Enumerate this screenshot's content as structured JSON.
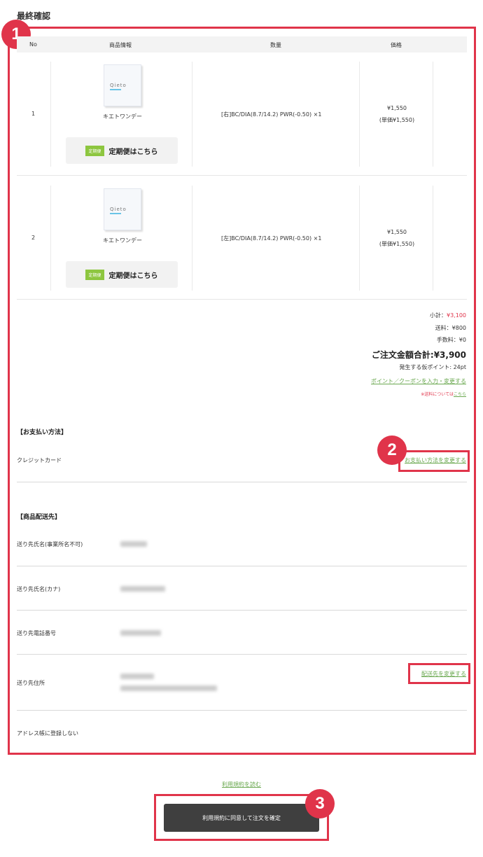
{
  "page": {
    "title": "最終確認"
  },
  "annotations": [
    "1",
    "2",
    "3"
  ],
  "table": {
    "headers": {
      "no": "No",
      "product": "商品情報",
      "qty": "数量",
      "price": "価格"
    },
    "rows": [
      {
        "no": "1",
        "logo": "Qieto",
        "name": "キエトワンデー",
        "sub_tag": "定期便",
        "sub_label": "定期便はこちら",
        "qty": "[右]BC/DIA(8.7/14.2) PWR(-0.50) ×1",
        "price": "¥1,550",
        "unit_price": "(単価¥1,550)"
      },
      {
        "no": "2",
        "logo": "Qieto",
        "name": "キエトワンデー",
        "sub_tag": "定期便",
        "sub_label": "定期便はこちら",
        "qty": "[左]BC/DIA(8.7/14.2) PWR(-0.50) ×1",
        "price": "¥1,550",
        "unit_price": "(単価¥1,550)"
      }
    ]
  },
  "totals": {
    "subtotal_label": "小計：",
    "subtotal_value": "¥3,100",
    "shipping": "送料：¥800",
    "fee": "手数料：¥0",
    "grand_total": "ご注文金額合計:¥3,900",
    "points": "発生する仮ポイント: 24pt",
    "coupon_link": "ポイント／クーポンを入力・変更する",
    "shipping_note_prefix": "※送料については",
    "shipping_note_link": "こちら"
  },
  "payment": {
    "title": "【お支払い方法】",
    "method": "クレジットカード",
    "change_link": "お支払い方法を変更する"
  },
  "delivery": {
    "title": "【商品配送先】",
    "name_label": "送り先氏名(事業所名不可)",
    "kana_label": "送り先氏名(カナ)",
    "phone_label": "送り先電話番号",
    "address_label": "送り先住所",
    "change_link": "配送先を変更する",
    "no_register": "アドレス帳に登録しない"
  },
  "footer": {
    "terms_link": "利用規約を読む",
    "confirm_button": "利用規約に同意して注文を確定"
  },
  "colors": {
    "accent_red": "#e0344a",
    "link_green": "#6aa84f",
    "button_dark": "#3f3f3f"
  }
}
